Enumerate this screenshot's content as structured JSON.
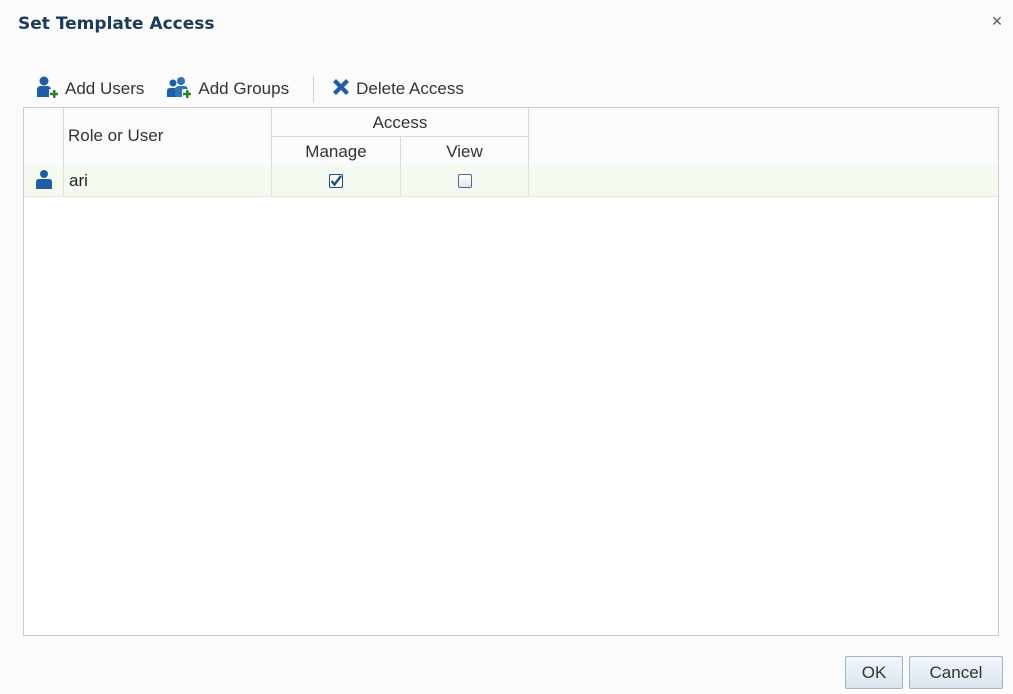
{
  "dialog": {
    "title": "Set Template Access",
    "close_symbol": "×"
  },
  "toolbar": {
    "add_users_label": "Add Users",
    "add_users_icon": "add-user-icon",
    "add_groups_label": "Add Groups",
    "add_groups_icon": "add-group-icon",
    "delete_access_label": "Delete Access",
    "delete_access_icon": "delete-x-icon"
  },
  "table": {
    "headers": {
      "role_or_user": "Role or User",
      "access": "Access",
      "manage": "Manage",
      "view": "View"
    },
    "rows": [
      {
        "type_icon": "user-icon",
        "name": "ari",
        "manage": true,
        "view": false
      }
    ]
  },
  "footer": {
    "ok_label": "OK",
    "cancel_label": "Cancel"
  },
  "colors": {
    "title": "#1b3b58",
    "icon_blue": "#1f5ea0",
    "delete_blue": "#1f5ea0",
    "row_highlight": "#f4faf0"
  }
}
